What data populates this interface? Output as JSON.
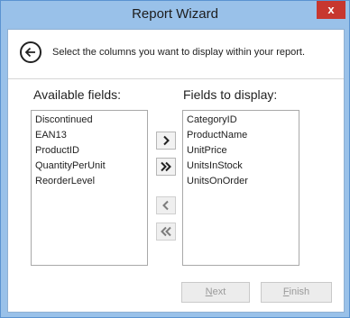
{
  "window": {
    "title": "Report Wizard",
    "close_glyph": "x"
  },
  "header": {
    "instruction": "Select the columns you want to display within your report."
  },
  "available": {
    "label": "Available fields:",
    "items": [
      "Discontinued",
      "EAN13",
      "ProductID",
      "QuantityPerUnit",
      "ReorderLevel"
    ]
  },
  "display": {
    "label": "Fields to display:",
    "items": [
      "CategoryID",
      "ProductName",
      "UnitPrice",
      "UnitsInStock",
      "UnitsOnOrder"
    ]
  },
  "buttons": {
    "next": {
      "mnemonic": "N",
      "rest": "ext"
    },
    "finish": {
      "mnemonic": "F",
      "rest": "inish"
    }
  },
  "icons": {
    "back": "back-arrow-icon",
    "add_one": "chevron-right-icon",
    "add_all": "double-chevron-right-icon",
    "remove_one": "chevron-left-icon",
    "remove_all": "double-chevron-left-icon"
  },
  "colors": {
    "frame": "#99c1e9",
    "close": "#c7372f",
    "disabled_text": "#9a9a9a"
  }
}
